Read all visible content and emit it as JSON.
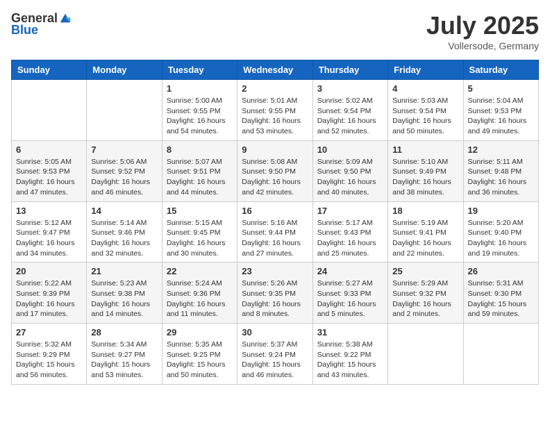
{
  "header": {
    "logo_general": "General",
    "logo_blue": "Blue",
    "title": "July 2025",
    "subtitle": "Vollersode, Germany"
  },
  "days_of_week": [
    "Sunday",
    "Monday",
    "Tuesday",
    "Wednesday",
    "Thursday",
    "Friday",
    "Saturday"
  ],
  "weeks": [
    [
      {
        "day": "",
        "info": ""
      },
      {
        "day": "",
        "info": ""
      },
      {
        "day": "1",
        "info": "Sunrise: 5:00 AM\nSunset: 9:55 PM\nDaylight: 16 hours and 54 minutes."
      },
      {
        "day": "2",
        "info": "Sunrise: 5:01 AM\nSunset: 9:55 PM\nDaylight: 16 hours and 53 minutes."
      },
      {
        "day": "3",
        "info": "Sunrise: 5:02 AM\nSunset: 9:54 PM\nDaylight: 16 hours and 52 minutes."
      },
      {
        "day": "4",
        "info": "Sunrise: 5:03 AM\nSunset: 9:54 PM\nDaylight: 16 hours and 50 minutes."
      },
      {
        "day": "5",
        "info": "Sunrise: 5:04 AM\nSunset: 9:53 PM\nDaylight: 16 hours and 49 minutes."
      }
    ],
    [
      {
        "day": "6",
        "info": "Sunrise: 5:05 AM\nSunset: 9:53 PM\nDaylight: 16 hours and 47 minutes."
      },
      {
        "day": "7",
        "info": "Sunrise: 5:06 AM\nSunset: 9:52 PM\nDaylight: 16 hours and 46 minutes."
      },
      {
        "day": "8",
        "info": "Sunrise: 5:07 AM\nSunset: 9:51 PM\nDaylight: 16 hours and 44 minutes."
      },
      {
        "day": "9",
        "info": "Sunrise: 5:08 AM\nSunset: 9:50 PM\nDaylight: 16 hours and 42 minutes."
      },
      {
        "day": "10",
        "info": "Sunrise: 5:09 AM\nSunset: 9:50 PM\nDaylight: 16 hours and 40 minutes."
      },
      {
        "day": "11",
        "info": "Sunrise: 5:10 AM\nSunset: 9:49 PM\nDaylight: 16 hours and 38 minutes."
      },
      {
        "day": "12",
        "info": "Sunrise: 5:11 AM\nSunset: 9:48 PM\nDaylight: 16 hours and 36 minutes."
      }
    ],
    [
      {
        "day": "13",
        "info": "Sunrise: 5:12 AM\nSunset: 9:47 PM\nDaylight: 16 hours and 34 minutes."
      },
      {
        "day": "14",
        "info": "Sunrise: 5:14 AM\nSunset: 9:46 PM\nDaylight: 16 hours and 32 minutes."
      },
      {
        "day": "15",
        "info": "Sunrise: 5:15 AM\nSunset: 9:45 PM\nDaylight: 16 hours and 30 minutes."
      },
      {
        "day": "16",
        "info": "Sunrise: 5:16 AM\nSunset: 9:44 PM\nDaylight: 16 hours and 27 minutes."
      },
      {
        "day": "17",
        "info": "Sunrise: 5:17 AM\nSunset: 9:43 PM\nDaylight: 16 hours and 25 minutes."
      },
      {
        "day": "18",
        "info": "Sunrise: 5:19 AM\nSunset: 9:41 PM\nDaylight: 16 hours and 22 minutes."
      },
      {
        "day": "19",
        "info": "Sunrise: 5:20 AM\nSunset: 9:40 PM\nDaylight: 16 hours and 19 minutes."
      }
    ],
    [
      {
        "day": "20",
        "info": "Sunrise: 5:22 AM\nSunset: 9:39 PM\nDaylight: 16 hours and 17 minutes."
      },
      {
        "day": "21",
        "info": "Sunrise: 5:23 AM\nSunset: 9:38 PM\nDaylight: 16 hours and 14 minutes."
      },
      {
        "day": "22",
        "info": "Sunrise: 5:24 AM\nSunset: 9:36 PM\nDaylight: 16 hours and 11 minutes."
      },
      {
        "day": "23",
        "info": "Sunrise: 5:26 AM\nSunset: 9:35 PM\nDaylight: 16 hours and 8 minutes."
      },
      {
        "day": "24",
        "info": "Sunrise: 5:27 AM\nSunset: 9:33 PM\nDaylight: 16 hours and 5 minutes."
      },
      {
        "day": "25",
        "info": "Sunrise: 5:29 AM\nSunset: 9:32 PM\nDaylight: 16 hours and 2 minutes."
      },
      {
        "day": "26",
        "info": "Sunrise: 5:31 AM\nSunset: 9:30 PM\nDaylight: 15 hours and 59 minutes."
      }
    ],
    [
      {
        "day": "27",
        "info": "Sunrise: 5:32 AM\nSunset: 9:29 PM\nDaylight: 15 hours and 56 minutes."
      },
      {
        "day": "28",
        "info": "Sunrise: 5:34 AM\nSunset: 9:27 PM\nDaylight: 15 hours and 53 minutes."
      },
      {
        "day": "29",
        "info": "Sunrise: 5:35 AM\nSunset: 9:25 PM\nDaylight: 15 hours and 50 minutes."
      },
      {
        "day": "30",
        "info": "Sunrise: 5:37 AM\nSunset: 9:24 PM\nDaylight: 15 hours and 46 minutes."
      },
      {
        "day": "31",
        "info": "Sunrise: 5:38 AM\nSunset: 9:22 PM\nDaylight: 15 hours and 43 minutes."
      },
      {
        "day": "",
        "info": ""
      },
      {
        "day": "",
        "info": ""
      }
    ]
  ]
}
